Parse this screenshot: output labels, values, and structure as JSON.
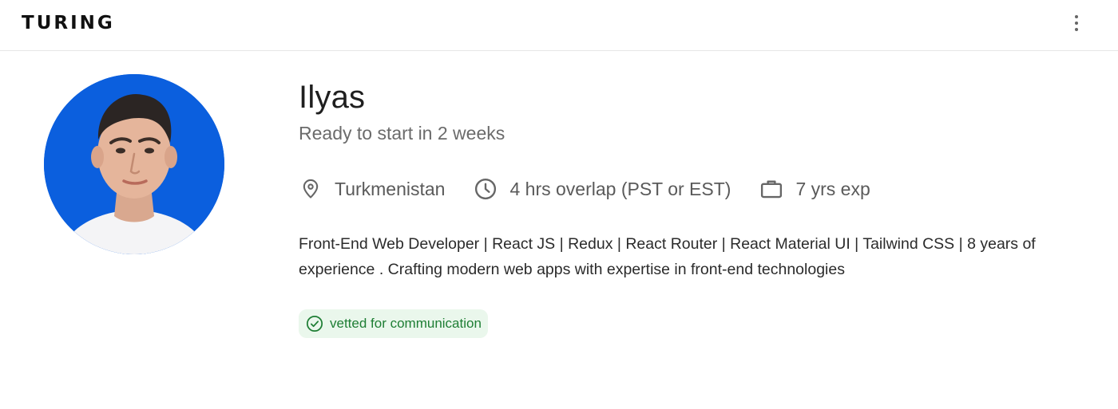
{
  "header": {
    "logo_text": "TURING",
    "menu_icon": "more-vertical-icon"
  },
  "profile": {
    "avatar_icon": "profile-photo",
    "name": "Ilyas",
    "availability": "Ready to start in 2 weeks",
    "location": {
      "icon": "location-pin-icon",
      "text": "Turkmenistan"
    },
    "overlap": {
      "icon": "clock-icon",
      "text": "4 hrs overlap (PST or EST)"
    },
    "experience": {
      "icon": "briefcase-icon",
      "text": "7 yrs exp"
    },
    "bio": "Front-End Web Developer | React JS | Redux | React Router | React Material UI | Tailwind CSS | 8 years of experience . Crafting modern web apps with expertise in front-end technologies",
    "badge": {
      "icon": "check-circle-icon",
      "text": "vetted for communication"
    }
  },
  "colors": {
    "avatar_background": "#0b5fde",
    "badge_background": "#eaf7ec",
    "badge_text": "#1e7e34",
    "muted_text": "#6b6b6b"
  }
}
